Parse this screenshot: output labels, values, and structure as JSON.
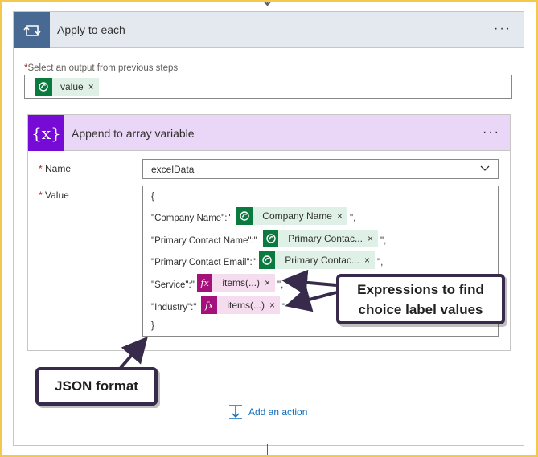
{
  "loop": {
    "title": "Apply to each",
    "more": "···",
    "select_label": "Select an output from previous steps",
    "required_mark": "*",
    "token_value": "value",
    "remove": "×"
  },
  "append": {
    "title": "Append to array variable",
    "icon_text": "{x}",
    "more": "···",
    "name_label": "Name",
    "name_value": "excelData",
    "value_label": "Value",
    "fx_label": "fx",
    "json": {
      "open": "{",
      "close": "}",
      "l1_key": "\"Company Name\":\"",
      "l1_token": "Company Name",
      "l1_tail": "\",",
      "l2_key": "\"Primary Contact Name\":\"",
      "l2_token": "Primary Contac...",
      "l2_tail": "\",",
      "l3_key": "\"Primary Contact Email\":\"",
      "l3_token": "Primary Contac...",
      "l3_tail": "\",",
      "l4_key": "\"Service\":\"",
      "l4_token": "items(...)",
      "l4_tail": "\",",
      "l5_key": "\"Industry\":\"",
      "l5_token": "items(...)",
      "l5_tail": "\""
    }
  },
  "callouts": {
    "expressions_line1": "Expressions to find",
    "expressions_line2": "choice label values",
    "json_format": "JSON format"
  },
  "add_action": "Add an action",
  "colors": {
    "loop_header": "#e4e9f0",
    "loop_icon": "#486991",
    "dataverse_icon": "#0a7a3f",
    "dynamic_token": "#dff1e6",
    "variable_icon": "#770bd6",
    "variable_header": "#ead6f6",
    "expression_icon": "#a5117a",
    "expression_token": "#f6dcef",
    "callout_border": "#372a4b",
    "link": "#0f6cbd",
    "frame": "#f2c94c"
  }
}
